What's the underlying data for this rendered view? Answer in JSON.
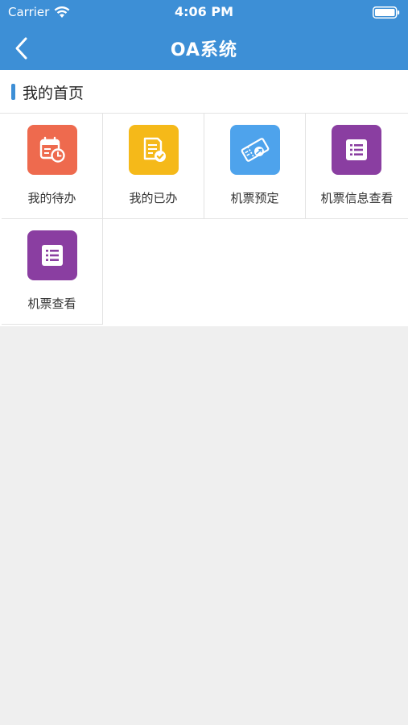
{
  "status_bar": {
    "carrier": "Carrier",
    "time": "4:06 PM"
  },
  "nav": {
    "title": "OA系统",
    "back_icon": "chevron-left-icon"
  },
  "section": {
    "title": "我的首页"
  },
  "tiles": [
    {
      "label": "我的待办",
      "icon": "calendar-clock-icon",
      "color": "#ee6a4e"
    },
    {
      "label": "我的已办",
      "icon": "document-check-icon",
      "color": "#f5b919"
    },
    {
      "label": "机票预定",
      "icon": "ticket-plane-icon",
      "color": "#4ea3ec"
    },
    {
      "label": "机票信息查看",
      "icon": "list-icon",
      "color": "#8a3ea1"
    },
    {
      "label": "机票查看",
      "icon": "list-icon",
      "color": "#8a3ea1"
    }
  ],
  "colors": {
    "nav_background": "#3d8fd6",
    "page_background": "#efefef"
  }
}
